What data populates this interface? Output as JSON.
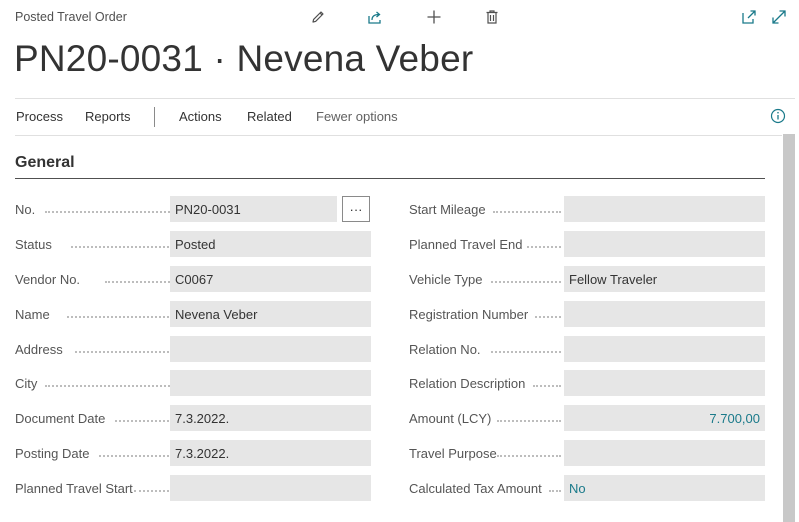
{
  "page": {
    "caption": "Posted Travel Order",
    "title": "PN20-0031 · Nevena Veber"
  },
  "toolbar": {
    "icons": [
      "edit-icon",
      "share-icon",
      "add-icon",
      "delete-icon",
      "open-new-window-icon",
      "expand-icon"
    ]
  },
  "actions": {
    "process": "Process",
    "reports": "Reports",
    "actions": "Actions",
    "related": "Related",
    "fewer_options": "Fewer options"
  },
  "section": {
    "title": "General"
  },
  "left_fields": [
    {
      "label": "No.",
      "value": "PN20-0031"
    },
    {
      "label": "Status",
      "value": "Posted"
    },
    {
      "label": "Vendor No.",
      "value": "C0067"
    },
    {
      "label": "Name",
      "value": "Nevena Veber"
    },
    {
      "label": "Address",
      "value": ""
    },
    {
      "label": "City",
      "value": ""
    },
    {
      "label": "Document Date",
      "value": "7.3.2022."
    },
    {
      "label": "Posting Date",
      "value": "7.3.2022."
    },
    {
      "label": "Planned Travel Start",
      "value": ""
    }
  ],
  "assist_button": "···",
  "right_fields": [
    {
      "label": "Start Mileage",
      "value": ""
    },
    {
      "label": "Planned Travel End",
      "value": ""
    },
    {
      "label": "Vehicle Type",
      "value": "Fellow Traveler"
    },
    {
      "label": "Registration Number",
      "value": ""
    },
    {
      "label": "Relation No.",
      "value": ""
    },
    {
      "label": "Relation Description",
      "value": ""
    },
    {
      "label": "Amount (LCY)",
      "value": "7.700,00"
    },
    {
      "label": "Travel Purpose",
      "value": ""
    },
    {
      "label": "Calculated Tax Amount",
      "value": "No"
    }
  ],
  "colors": {
    "accent": "#1a7a8a",
    "field_bg": "#e6e6e6"
  }
}
